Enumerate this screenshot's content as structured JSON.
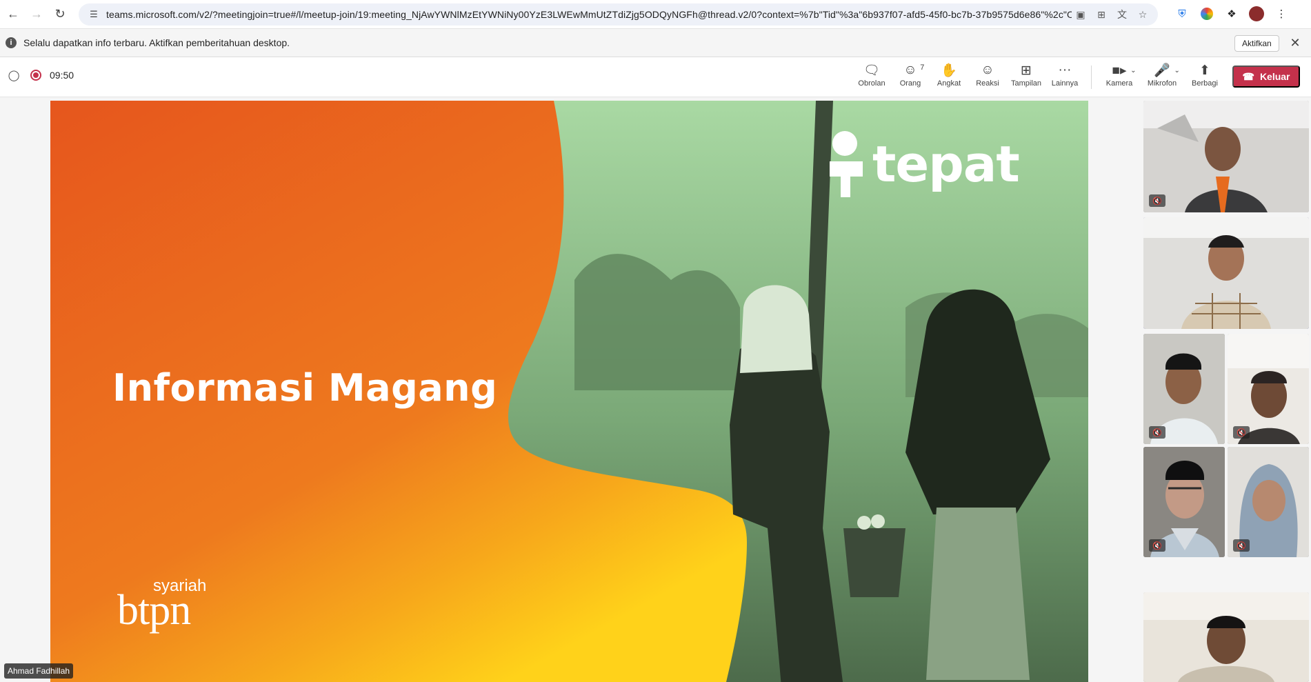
{
  "browser": {
    "url": "teams.microsoft.com/v2/?meetingjoin=true#/l/meetup-join/19:meeting_NjAwYWNlMzEtYWNiNy00YzE3LWEwMmUtZTdiZjg5ODQyNGFh@thread.v2/0?context=%7b\"Tid\"%3a\"6b937f07-afd5-45f0-bc7b-37b9575d6e86\"%2c\"Oid\"..."
  },
  "notification": {
    "message": "Selalu dapatkan info terbaru. Aktifkan pemberitahuan desktop.",
    "enable_label": "Aktifkan"
  },
  "meeting": {
    "timer": "09:50",
    "actions": [
      {
        "label": "Obrolan",
        "icon": "chat-icon"
      },
      {
        "label": "Orang",
        "icon": "people-icon",
        "count": "7"
      },
      {
        "label": "Angkat",
        "icon": "raise-hand-icon"
      },
      {
        "label": "Reaksi",
        "icon": "reaction-icon"
      },
      {
        "label": "Tampilan",
        "icon": "view-icon"
      },
      {
        "label": "Lainnya",
        "icon": "more-icon"
      }
    ],
    "media": [
      {
        "label": "Kamera",
        "icon": "camera-icon"
      },
      {
        "label": "Mikrofon",
        "icon": "mic-off-icon"
      },
      {
        "label": "Berbagi",
        "icon": "share-icon"
      }
    ],
    "leave_label": "Keluar",
    "leave_color": "#c4314b"
  },
  "slide": {
    "title": "Informasi Magang",
    "brand_sub": "syariah",
    "brand_main": "btpn",
    "logo_word": "tepat",
    "bg_color": "#e55b1f"
  },
  "presenter_name": "Ahmad Fadhillah"
}
